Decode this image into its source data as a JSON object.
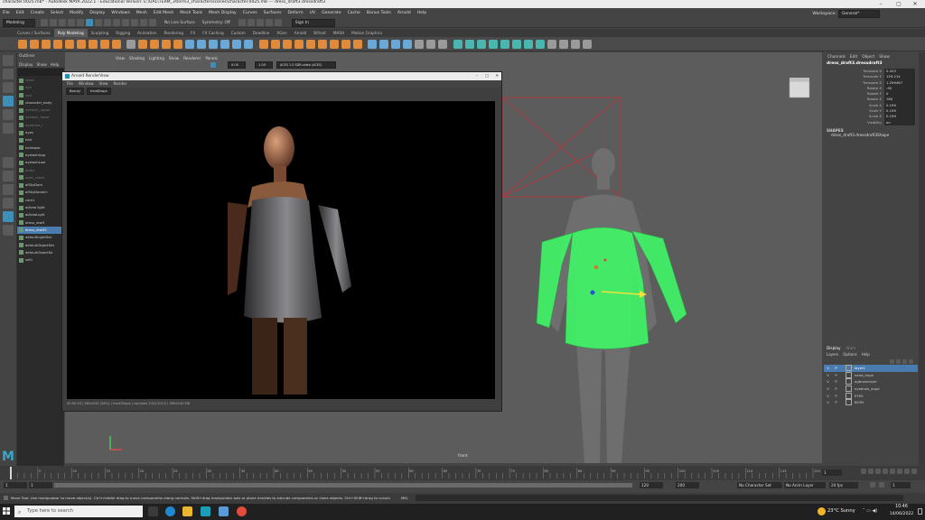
{
  "titlebar": {
    "title": "character.0025.mb* - Autodesk MAYA 2022.1 - Educational Version: E:\\UAL\\TERM_3\\term3_character\\scenes\\character.0025.mb  ---  dress_draft3.dressdraft3"
  },
  "menubar": {
    "items": [
      "File",
      "Edit",
      "Create",
      "Select",
      "Modify",
      "Display",
      "Windows",
      "Mesh",
      "Edit Mesh",
      "Mesh Tools",
      "Mesh Display",
      "Curves",
      "Surfaces",
      "Deform",
      "UV",
      "Generate",
      "Cache",
      "Bonus Tools",
      "Arnold",
      "Help"
    ],
    "workspace_label": "Workspace:",
    "workspace_value": "General*"
  },
  "statusline": {
    "mode": "Modeling",
    "no_live": "No Live Surface",
    "symmetry": "Symmetry: Off",
    "signin": "Sign In"
  },
  "shelf": {
    "tabs": [
      "Curves / Surfaces",
      "Poly Modeling",
      "Sculpting",
      "Rigging",
      "Animation",
      "Rendering",
      "FX",
      "FX Caching",
      "Custom",
      "Deadline",
      "XGen",
      "Arnold",
      "Bifrost",
      "MASH",
      "Motion Graphics"
    ],
    "active": "Poly Modeling"
  },
  "outliner": {
    "title": "Outliner",
    "menu": [
      "Display",
      "Show",
      "Help"
    ],
    "items": [
      {
        "label": "head",
        "state": "dim"
      },
      {
        "label": "eye",
        "state": "dim"
      },
      {
        "label": "eye",
        "state": "dim"
      },
      {
        "label": "character_body",
        "state": "normal"
      },
      {
        "label": "eyelash_upper",
        "state": "dim"
      },
      {
        "label": "eyelash_lower",
        "state": "dim"
      },
      {
        "label": "eyebrow_l",
        "state": "dim"
      },
      {
        "label": "eyes",
        "state": "normal"
      },
      {
        "label": "hair",
        "state": "normal"
      },
      {
        "label": "hairbase",
        "state": "normal"
      },
      {
        "label": "eyelashUpp",
        "state": "normal"
      },
      {
        "label": "eyelashLow",
        "state": "normal"
      },
      {
        "label": "bodyr",
        "state": "dim"
      },
      {
        "label": "eyes_clean",
        "state": "dim"
      },
      {
        "label": "aiSkyDom",
        "state": "normal"
      },
      {
        "label": "aiSkyDomeLi",
        "state": "normal"
      },
      {
        "label": "cam1",
        "state": "normal"
      },
      {
        "label": "aiArea light",
        "state": "normal"
      },
      {
        "label": "aiAreaLight",
        "state": "normal"
      },
      {
        "label": "dress_draft",
        "state": "normal"
      },
      {
        "label": "dress_draft3",
        "state": "hl"
      },
      {
        "label": "defaultLightSet",
        "state": "normal"
      },
      {
        "label": "defaultObjectSet",
        "state": "normal"
      },
      {
        "label": "defaultObjectSe",
        "state": "normal"
      },
      {
        "label": "set1",
        "state": "normal"
      }
    ]
  },
  "viewport": {
    "menu": [
      "View",
      "Shading",
      "Lighting",
      "Show",
      "Renderer",
      "Panels"
    ],
    "field_a": "0.00",
    "field_b": "1.00",
    "colorspace": "ACES 1.0 SDR-video (ACES)",
    "camera_label": "front"
  },
  "renderview": {
    "title": "Arnold RenderView",
    "menu": [
      "File",
      "Window",
      "View",
      "Render"
    ],
    "mode": "Beauty",
    "camera": "frontShape",
    "footer": "00:00:03 | 960x540 (26%) | frontShape | samples 3/3/2/2/2/2 | 960x540 MB"
  },
  "channelbox": {
    "tabs": [
      "Channels",
      "Edit",
      "Object",
      "Show"
    ],
    "object": "dress_draft3.dressdraft3",
    "attrs": [
      {
        "name": "Translate X",
        "value": "0.203"
      },
      {
        "name": "Translate Y",
        "value": "159.214"
      },
      {
        "name": "Translate Z",
        "value": "1.299467"
      },
      {
        "name": "Rotate X",
        "value": "-90"
      },
      {
        "name": "Rotate Y",
        "value": "0"
      },
      {
        "name": "Rotate Z",
        "value": "180"
      },
      {
        "name": "Scale X",
        "value": "0.199"
      },
      {
        "name": "Scale Y",
        "value": "0.199"
      },
      {
        "name": "Scale Z",
        "value": "0.199"
      },
      {
        "name": "Visibility",
        "value": "on"
      }
    ],
    "shapes_label": "SHAPES",
    "shape_name": "dress_draft3.dressdraft3Shape"
  },
  "layers": {
    "tabs": [
      "Display",
      "Anim"
    ],
    "menu": [
      "Layers",
      "Options",
      "Help"
    ],
    "items": [
      {
        "v": "V",
        "p": "P",
        "label": "layer1",
        "hl": true
      },
      {
        "v": "V",
        "p": "P",
        "label": "head_dupe",
        "hl": false
      },
      {
        "v": "V",
        "p": "P",
        "label": "ogbrosnlayer",
        "hl": false
      },
      {
        "v": "V",
        "p": "P",
        "label": "eyebrow_dupe",
        "hl": false
      },
      {
        "v": "V",
        "p": "P",
        "label": "EYES",
        "hl": false
      },
      {
        "v": "V",
        "p": "P",
        "label": "BODY",
        "hl": false
      }
    ]
  },
  "timeline": {
    "ticks": [
      "5",
      "10",
      "15",
      "20",
      "25",
      "30",
      "35",
      "40",
      "45",
      "50",
      "55",
      "60",
      "65",
      "70",
      "75",
      "80",
      "85",
      "90",
      "95",
      "100",
      "105",
      "110",
      "115",
      "120"
    ],
    "current": "1"
  },
  "range": {
    "start": "1",
    "start2": "1",
    "end1": "120",
    "end2": "200",
    "char_set": "No Character Set",
    "anim_layer": "No Anim Layer",
    "fps": "24 fps",
    "frame": "1"
  },
  "helpline": {
    "left": "Move Tool: Use manipulator to move object(s). Ctrl+middle drag to move components along normals. Shift+drag manipulator axis or plane handles to extrude components or clone objects. Ctrl+Shift+drag to constrain movement to a co",
    "mel": "MEL"
  },
  "taskbar": {
    "search": "Type here to search",
    "weather": "23°C  Sunny",
    "time": "10:46",
    "date": "14/06/2022"
  },
  "colors": {
    "accent": "#3e8fb8",
    "outliner_highlight": "#4a7cb0",
    "wireframe": "#3dff66",
    "render_bg": "#000000"
  }
}
